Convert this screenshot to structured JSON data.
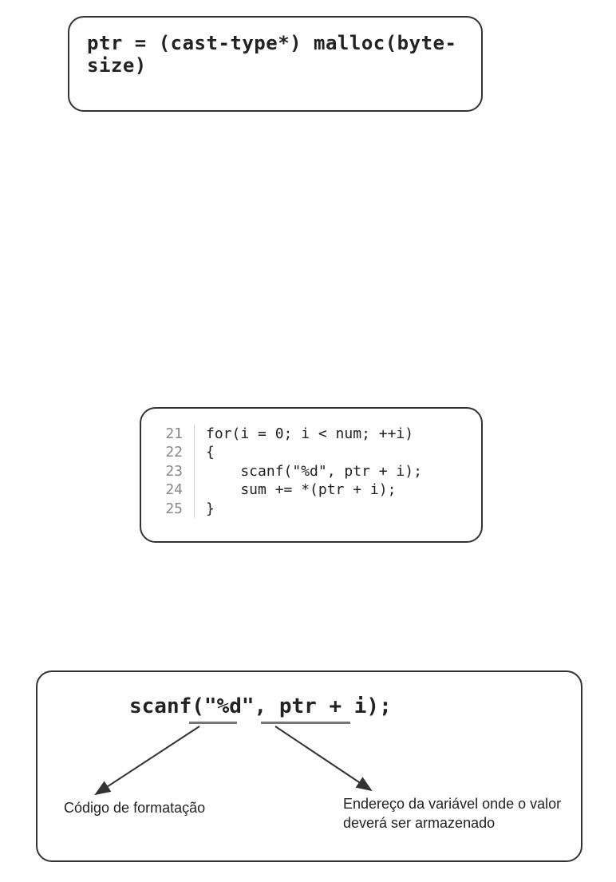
{
  "panel1": {
    "code": "ptr = (cast-type*) malloc(byte-size)"
  },
  "panel2": {
    "lineNumbers": [
      "21",
      "22",
      "23",
      "24",
      "25"
    ],
    "lines": [
      "for(i = 0; i < num; ++i)",
      "{",
      "    scanf(\"%d\", ptr + i);",
      "    sum += *(ptr + i);",
      "}"
    ]
  },
  "panel3": {
    "scanf_line": "scanf(\"%d\", ptr + i);",
    "label_left": "Código de formatação",
    "label_right": "Endereço da variável onde o valor deverá ser armazenado"
  }
}
